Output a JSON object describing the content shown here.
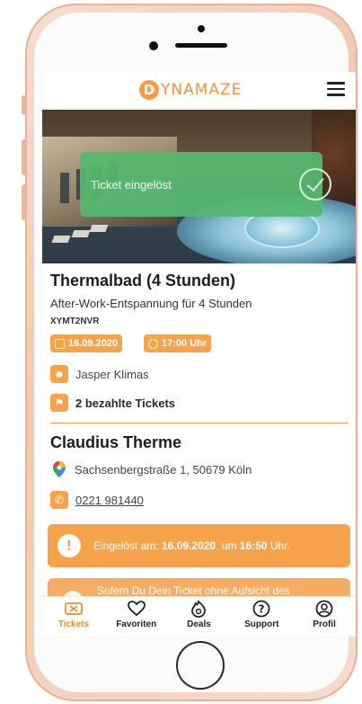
{
  "app": {
    "logo_initial": "D",
    "logo_text": "YNAMAZE"
  },
  "toast": {
    "message": "Ticket eingelöst"
  },
  "ticket": {
    "title": "Thermalbad (4 Stunden)",
    "subtitle": "After-Work-Entspannung für 4 Stunden",
    "code": "XYMT2NVR",
    "date": "16.09.2020",
    "time": "17:00 Uhr",
    "holder": "Jasper Klimas",
    "tickets_paid": "2 bezahlte Tickets"
  },
  "venue": {
    "name": "Claudius Therme",
    "address": "Sachsenbergstraße 1, 50679 Köln",
    "phone": "0221 981440"
  },
  "notice": {
    "prefix": "Eingelöst am: ",
    "date": "16.09.2020",
    "middle": ", um ",
    "time": "16:50",
    "suffix": " Uhr."
  },
  "notice2": {
    "text": "Sofern Du Dein Ticket ohne Aufsicht des"
  },
  "nav": {
    "items": [
      {
        "label": "Tickets",
        "icon": "ticket-icon",
        "active": true
      },
      {
        "label": "Favoriten",
        "icon": "heart-icon",
        "active": false
      },
      {
        "label": "Deals",
        "icon": "deals-icon",
        "active": false
      },
      {
        "label": "Support",
        "icon": "support-icon",
        "active": false
      },
      {
        "label": "Profil",
        "icon": "profile-icon",
        "active": false
      }
    ]
  },
  "colors": {
    "accent": "#f5a24b",
    "success": "#55b96f",
    "active_nav": "#f08a2c"
  }
}
